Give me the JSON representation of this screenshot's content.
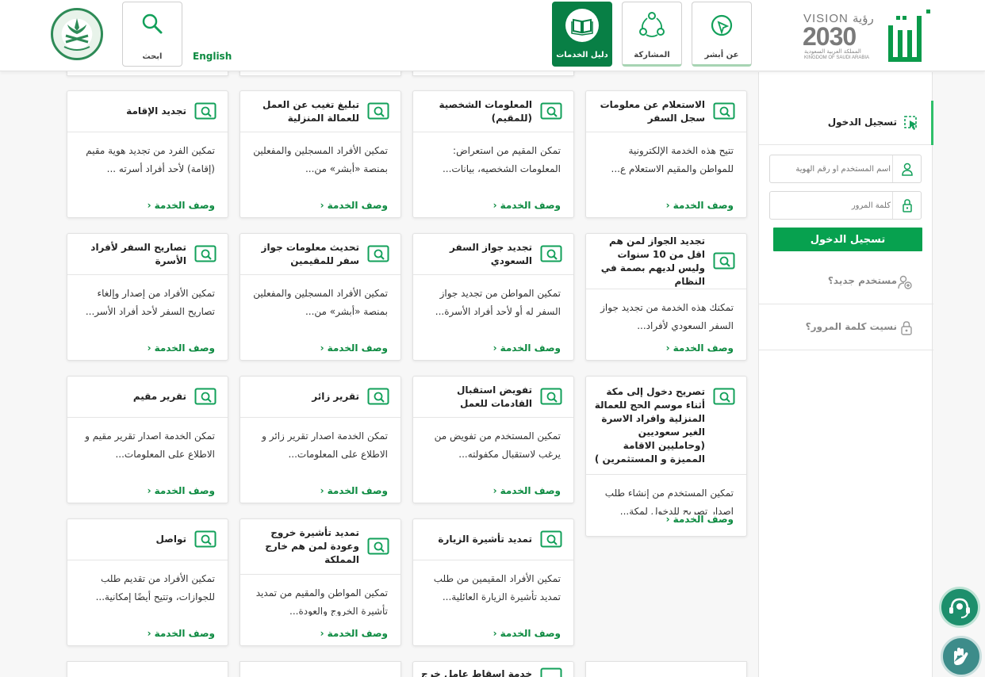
{
  "header": {
    "search_label": "ابحث",
    "english_label": "English",
    "nav": [
      {
        "label": "دليل الخدمات",
        "active": true
      },
      {
        "label": "المشاركة",
        "active": false
      },
      {
        "label": "عن أبشر",
        "active": false
      }
    ],
    "vision_word": "VISION رؤية",
    "vision_year": "2030",
    "vision_ar": "المملكة العربية السعودية",
    "vision_en": "KINGDOM OF SAUDI ARABIA"
  },
  "services": {
    "link_label": "وصف الخدمة",
    "chevron": "‹",
    "cards": [
      {
        "title": "الاستعلام عن معلومات سجل السفر",
        "desc": "تتيح هذه الخدمة الإلكترونية للمواطن والمقيم الاستعلام ع..."
      },
      {
        "title": "المعلومات الشخصية (للمقيم)",
        "desc": "تمكن المقيم من استعراض: المعلومات الشخصيه، بيانات..."
      },
      {
        "title": "تبليغ تغيب عن العمل للعمالة المنزلية",
        "desc": "تمكين الأفراد المسجلين والمفعلين بمنصة «أبشر» من..."
      },
      {
        "title": "تجديد الإقامة",
        "desc": "تمكين الفرد من تجديد هوية مقيم (إقامة) لأحد أفراد أسرته ..."
      },
      {
        "title": "تجديد الجواز لمن هم اقل من 10 سنوات وليس لديهم بصمة في النظام",
        "desc": "تمكنك هذه الخدمة من تجديد جواز السفر السعودي لأفراد..."
      },
      {
        "title": "تجديد جواز السفر السعودي",
        "desc": "تمكين المواطن من تجديد جواز السفر له أو لأحد أفراد الأسرة..."
      },
      {
        "title": "تحديث معلومات جواز سفر للمقيمين",
        "desc": "تمكين الأفراد المسجلين والمفعلين بمنصة «أبشر» من..."
      },
      {
        "title": "تصاريح السفر لأفراد الأسرة",
        "desc": "تمكين الأفراد من إصدار وإلغاء تصاريح السفر لأحد أفراد الأسر..."
      },
      {
        "title": "تصريح دخول إلى مكة أثناء موسم الحج للعمالة المنزلية وافراد الاسرة الغير سعوديين (وحامليين الاقامة المميزة و المستثمرين )",
        "desc": "تمكين المستخدم من إنشاء طلب إصدار تصريح للدخول لمكة..."
      },
      {
        "title": "تفويض استقبال القادمات للعمل",
        "desc": "تمكين المستخدم من تفويض من يرغب لاستقبال مكفولته..."
      },
      {
        "title": "تقرير زائر",
        "desc": "تمكن الخدمة اصدار تقرير زائر و الاطلاع على المعلومات..."
      },
      {
        "title": "تقرير مقيم",
        "desc": "تمكن الخدمة اصدار تقرير مقيم و الاطلاع على المعلومات..."
      },
      {
        "title": "تمديد تأشيرة الزيارة",
        "desc": "تمكين الأفراد المقيمين من طلب تمديد تأشيرة الزيارة العائلية..."
      },
      {
        "title": "تمديد تأشيرة خروج وعودة لمن هم خارج المملكة",
        "desc": "تمكين المواطن والمقيم من تمديد تأشيرة الخروج والعودة..."
      },
      {
        "title": "تواصل",
        "desc": "تمكين الأفراد من تقديم طلب للجوازات، وتتيح أيضًا إمكانية..."
      },
      {
        "title": "خدمة اسقاط عامل خرج",
        "desc": ""
      }
    ]
  },
  "login": {
    "title": "تسجيل الدخول",
    "username_placeholder": "اسم المستخدم أو رقم الهوية",
    "password_placeholder": "كلمة المرور",
    "button": "تسجيل الدخول",
    "new_user": "مستخدم جديد؟",
    "forgot_password": "نسيت كلمة المرور؟"
  },
  "colors": {
    "brand_green": "#087f45",
    "link_green": "#0c8a40",
    "button_green": "#07a14f",
    "chat_teal": "#1d8f6c",
    "sign_teal": "#3d8c8a"
  },
  "icons": [
    "search-icon",
    "services-guide-icon",
    "participation-icon",
    "about-absher-icon",
    "service-icon",
    "login-icon",
    "user-icon",
    "lock-icon",
    "new-user-icon",
    "forgot-password-icon",
    "chat-support-icon",
    "sign-language-icon"
  ]
}
